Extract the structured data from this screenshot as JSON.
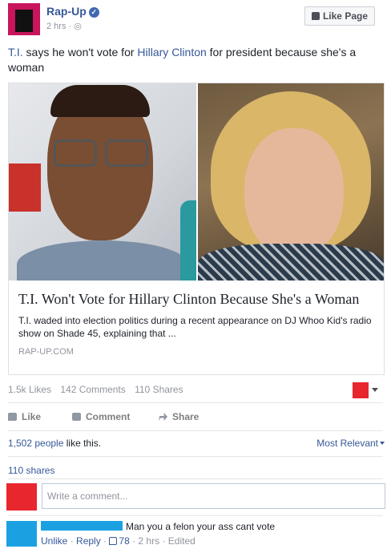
{
  "post": {
    "page_name": "Rap-Up",
    "time": "2 hrs",
    "meta_sep": " · ",
    "like_page_label": "Like Page",
    "text_prefix": "T.I. says he won't vote for ",
    "text_link": "Hillary Clinton",
    "text_suffix": " for president because she's a woman",
    "text_person": "T.I."
  },
  "attachment": {
    "title": "T.I. Won't Vote for Hillary Clinton Because She's a Woman",
    "description": "T.I. waded into election politics during a recent appearance on DJ Whoo Kid's radio show on Shade 45, explaining that ...",
    "source": "RAP-UP.COM"
  },
  "stats": {
    "likes": "1.5k Likes",
    "comments": "142 Comments",
    "shares": "110 Shares"
  },
  "actions": {
    "like": "Like",
    "comment": "Comment",
    "share": "Share"
  },
  "likes_summary": {
    "count": "1,502 people",
    "suffix": " like this.",
    "sort": "Most Relevant"
  },
  "shares_link": "110 shares",
  "comment_box": {
    "placeholder": "Write a comment..."
  },
  "comment": {
    "text": "Man you a felon your ass cant vote",
    "unlike": "Unlike",
    "reply": "Reply",
    "like_count": "78",
    "time": "2 hrs",
    "edited": "Edited",
    "sep": " · "
  },
  "colors": {
    "link": "#365899",
    "redaction_red": "#e8262d",
    "redaction_blue": "#1ba1e2",
    "page_avatar": "#c8155d"
  }
}
